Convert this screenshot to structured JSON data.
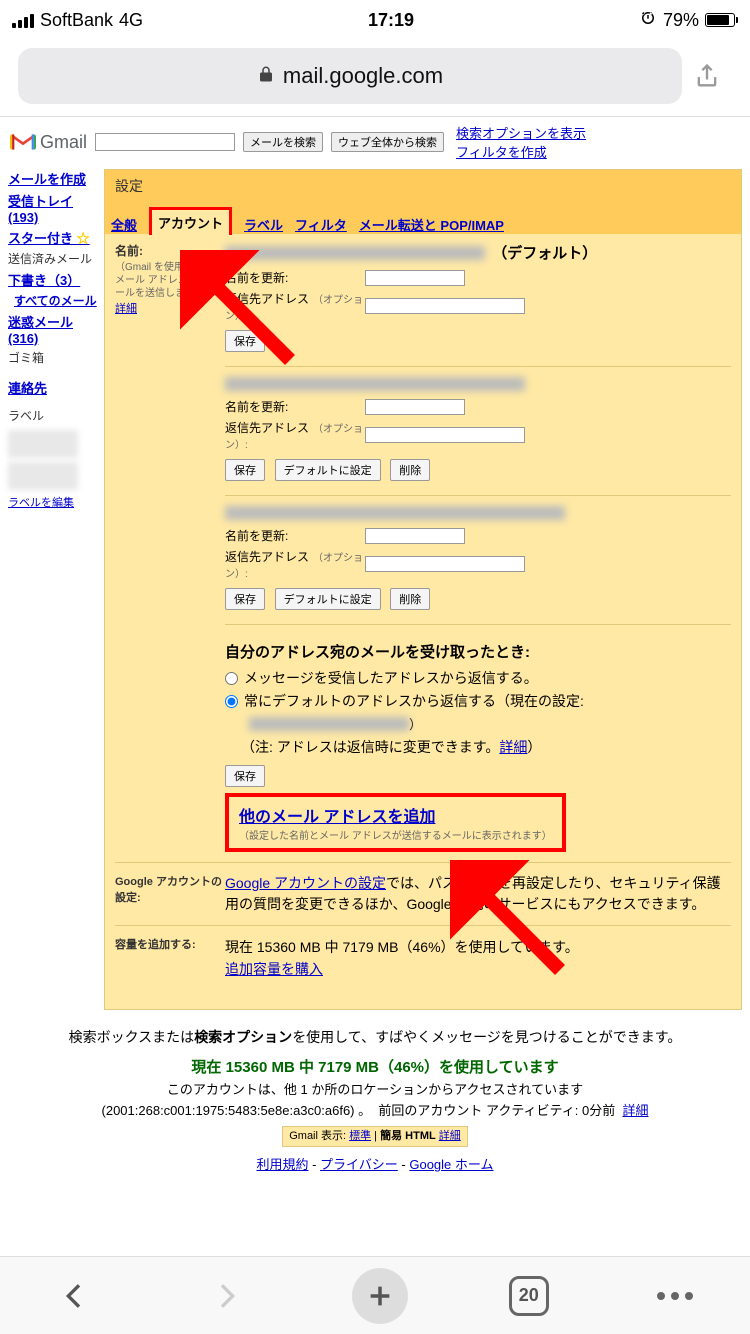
{
  "status": {
    "carrier": "SoftBank",
    "network": "4G",
    "time": "17:19",
    "battery_pct": "79%"
  },
  "url_bar": {
    "domain": "mail.google.com"
  },
  "header": {
    "gmail": "Gmail",
    "search_btn": "メールを検索",
    "web_search_btn": "ウェブ全体から検索",
    "search_options": "検索オプションを表示",
    "create_filter": "フィルタを作成"
  },
  "sidebar": {
    "compose": "メールを作成",
    "inbox": "受信トレイ (193)",
    "starred": "スター付き",
    "sent": "送信済みメール",
    "drafts": "下書き（3）",
    "all_mail": "すべてのメール",
    "spam": "迷惑メール (316)",
    "trash": "ゴミ箱",
    "contacts": "連絡先",
    "labels_title": "ラベル",
    "edit_labels": "ラベルを編集"
  },
  "settings": {
    "title": "設定",
    "tabs": {
      "general": "全般",
      "accounts": "アカウント",
      "labels": "ラベル",
      "filters": "フィルタ",
      "forwarding": "メール転送と POP/IMAP"
    },
    "name_section": {
      "label": "名前:",
      "desc": "（Gmail を使用して他のメール アドレスからメールを送信します）",
      "detail": "詳細"
    },
    "default_label": "（デフォルト）",
    "update_name": "名前を更新:",
    "reply_to": "返信先アドレス",
    "optional": "（オプション）:",
    "save_btn": "保存",
    "set_default_btn": "デフォルトに設定",
    "delete_btn": "削除",
    "reply_section": {
      "title": "自分のアドレス宛のメールを受け取ったとき:",
      "opt1": "メッセージを受信したアドレスから返信する。",
      "opt2": "常にデフォルトのアドレスから返信する（現在の設定:",
      "note_prefix": "（注: アドレスは返信時に変更できます。",
      "note_link": "詳細",
      "note_suffix": "）"
    },
    "add_address": {
      "link": "他のメール アドレスを追加",
      "hint": "（設定した名前とメール アドレスが送信するメールに表示されます）"
    },
    "google_account": {
      "label": "Google アカウントの設定:",
      "link": "Google アカウントの設定",
      "text1": "では、パスワードを再設定したり、セキュリティ保護用の質問を変更できるほか、Google の他のサービスにもアクセスできます。"
    },
    "storage": {
      "label": "容量を追加する:",
      "text": "現在 15360 MB 中 7179 MB（46%）を使用しています。",
      "link": "追加容量を購入"
    }
  },
  "footer": {
    "tip_prefix": "検索ボックスまたは",
    "tip_bold": "検索オプション",
    "tip_suffix": "を使用して、すばやくメッセージを見つけることができます。",
    "usage": "現在 15360 MB 中 7179 MB（46%）を使用しています",
    "location": "このアカウントは、他 1 か所のロケーションからアクセスされています",
    "ip": "(2001:268:c001:1975:5483:5e8e:a3c0:a6f6) 。",
    "activity": "前回のアカウント アクティビティ: 0分前",
    "detail": "詳細",
    "view_prefix": "Gmail 表示:",
    "view_std": "標準",
    "view_html": "簡易 HTML",
    "view_detail": "詳細",
    "terms": "利用規約",
    "privacy": "プライバシー",
    "google_home": "Google ホーム"
  },
  "bottom_bar": {
    "tab_count": "20"
  }
}
